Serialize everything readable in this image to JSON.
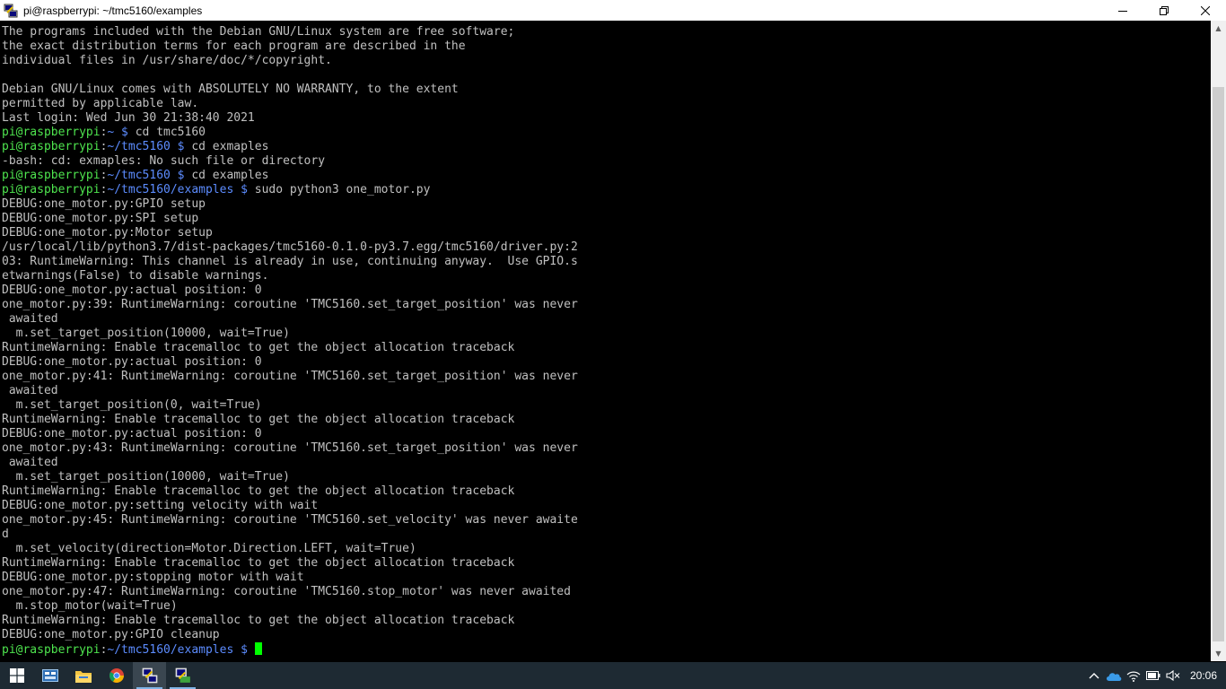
{
  "window": {
    "title": "pi@raspberrypi: ~/tmc5160/examples",
    "icon": "putty-icon",
    "controls": [
      "minimize-icon",
      "restore-icon",
      "close-icon"
    ]
  },
  "colors": {
    "default": "#c0c0c0",
    "prompt_user": "#4ee44e",
    "prompt_path": "#5c8cff",
    "cursor": "#00ff00",
    "background": "#000000"
  },
  "terminal": {
    "lines": [
      [
        {
          "t": "The programs included with the Debian GNU/Linux system are free software;",
          "c": "default"
        }
      ],
      [
        {
          "t": "the exact distribution terms for each program are described in the",
          "c": "default"
        }
      ],
      [
        {
          "t": "individual files in /usr/share/doc/*/copyright.",
          "c": "default"
        }
      ],
      [
        {
          "t": "",
          "c": "default"
        }
      ],
      [
        {
          "t": "Debian GNU/Linux comes with ABSOLUTELY NO WARRANTY, to the extent",
          "c": "default"
        }
      ],
      [
        {
          "t": "permitted by applicable law.",
          "c": "default"
        }
      ],
      [
        {
          "t": "Last login: Wed Jun 30 21:38:40 2021",
          "c": "default"
        }
      ],
      [
        {
          "t": "pi@raspberrypi",
          "c": "green"
        },
        {
          "t": ":",
          "c": "default"
        },
        {
          "t": "~ $",
          "c": "blue"
        },
        {
          "t": " cd tmc5160",
          "c": "default"
        }
      ],
      [
        {
          "t": "pi@raspberrypi",
          "c": "green"
        },
        {
          "t": ":",
          "c": "default"
        },
        {
          "t": "~/tmc5160 $",
          "c": "blue"
        },
        {
          "t": " cd exmaples",
          "c": "default"
        }
      ],
      [
        {
          "t": "-bash: cd: exmaples: No such file or directory",
          "c": "default"
        }
      ],
      [
        {
          "t": "pi@raspberrypi",
          "c": "green"
        },
        {
          "t": ":",
          "c": "default"
        },
        {
          "t": "~/tmc5160 $",
          "c": "blue"
        },
        {
          "t": " cd examples",
          "c": "default"
        }
      ],
      [
        {
          "t": "pi@raspberrypi",
          "c": "green"
        },
        {
          "t": ":",
          "c": "default"
        },
        {
          "t": "~/tmc5160/examples $",
          "c": "blue"
        },
        {
          "t": " sudo python3 one_motor.py",
          "c": "default"
        }
      ],
      [
        {
          "t": "DEBUG:one_motor.py:GPIO setup",
          "c": "default"
        }
      ],
      [
        {
          "t": "DEBUG:one_motor.py:SPI setup",
          "c": "default"
        }
      ],
      [
        {
          "t": "DEBUG:one_motor.py:Motor setup",
          "c": "default"
        }
      ],
      [
        {
          "t": "/usr/local/lib/python3.7/dist-packages/tmc5160-0.1.0-py3.7.egg/tmc5160/driver.py:2",
          "c": "default"
        }
      ],
      [
        {
          "t": "03: RuntimeWarning: This channel is already in use, continuing anyway.  Use GPIO.s",
          "c": "default"
        }
      ],
      [
        {
          "t": "etwarnings(False) to disable warnings.",
          "c": "default"
        }
      ],
      [
        {
          "t": "DEBUG:one_motor.py:actual position: 0",
          "c": "default"
        }
      ],
      [
        {
          "t": "one_motor.py:39: RuntimeWarning: coroutine 'TMC5160.set_target_position' was never",
          "c": "default"
        }
      ],
      [
        {
          "t": " awaited",
          "c": "default"
        }
      ],
      [
        {
          "t": "  m.set_target_position(10000, wait=True)",
          "c": "default"
        }
      ],
      [
        {
          "t": "RuntimeWarning: Enable tracemalloc to get the object allocation traceback",
          "c": "default"
        }
      ],
      [
        {
          "t": "DEBUG:one_motor.py:actual position: 0",
          "c": "default"
        }
      ],
      [
        {
          "t": "one_motor.py:41: RuntimeWarning: coroutine 'TMC5160.set_target_position' was never",
          "c": "default"
        }
      ],
      [
        {
          "t": " awaited",
          "c": "default"
        }
      ],
      [
        {
          "t": "  m.set_target_position(0, wait=True)",
          "c": "default"
        }
      ],
      [
        {
          "t": "RuntimeWarning: Enable tracemalloc to get the object allocation traceback",
          "c": "default"
        }
      ],
      [
        {
          "t": "DEBUG:one_motor.py:actual position: 0",
          "c": "default"
        }
      ],
      [
        {
          "t": "one_motor.py:43: RuntimeWarning: coroutine 'TMC5160.set_target_position' was never",
          "c": "default"
        }
      ],
      [
        {
          "t": " awaited",
          "c": "default"
        }
      ],
      [
        {
          "t": "  m.set_target_position(10000, wait=True)",
          "c": "default"
        }
      ],
      [
        {
          "t": "RuntimeWarning: Enable tracemalloc to get the object allocation traceback",
          "c": "default"
        }
      ],
      [
        {
          "t": "DEBUG:one_motor.py:setting velocity with wait",
          "c": "default"
        }
      ],
      [
        {
          "t": "one_motor.py:45: RuntimeWarning: coroutine 'TMC5160.set_velocity' was never awaite",
          "c": "default"
        }
      ],
      [
        {
          "t": "d",
          "c": "default"
        }
      ],
      [
        {
          "t": "  m.set_velocity(direction=Motor.Direction.LEFT, wait=True)",
          "c": "default"
        }
      ],
      [
        {
          "t": "RuntimeWarning: Enable tracemalloc to get the object allocation traceback",
          "c": "default"
        }
      ],
      [
        {
          "t": "DEBUG:one_motor.py:stopping motor with wait",
          "c": "default"
        }
      ],
      [
        {
          "t": "one_motor.py:47: RuntimeWarning: coroutine 'TMC5160.stop_motor' was never awaited",
          "c": "default"
        }
      ],
      [
        {
          "t": "  m.stop_motor(wait=True)",
          "c": "default"
        }
      ],
      [
        {
          "t": "RuntimeWarning: Enable tracemalloc to get the object allocation traceback",
          "c": "default"
        }
      ],
      [
        {
          "t": "DEBUG:one_motor.py:GPIO cleanup",
          "c": "default"
        }
      ],
      [
        {
          "t": "pi@raspberrypi",
          "c": "green"
        },
        {
          "t": ":",
          "c": "default"
        },
        {
          "t": "~/tmc5160/examples $",
          "c": "blue"
        },
        {
          "t": " ",
          "c": "default"
        }
      ]
    ]
  },
  "taskbar": {
    "items": [
      {
        "name": "start-button",
        "icon": "windows-logo-icon"
      },
      {
        "name": "task-view-button",
        "icon": "task-view-icon"
      },
      {
        "name": "file-explorer-button",
        "icon": "folder-icon"
      },
      {
        "name": "chrome-button",
        "icon": "chrome-icon"
      },
      {
        "name": "putty-taskbar-button",
        "icon": "putty-icon",
        "active": true
      },
      {
        "name": "putty-config-taskbar-button",
        "icon": "putty-config-icon"
      }
    ],
    "tray": [
      "chevron-up-icon",
      "onedrive-icon",
      "network-icon",
      "battery-icon",
      "volume-muted-icon"
    ],
    "clock": "20:06"
  }
}
